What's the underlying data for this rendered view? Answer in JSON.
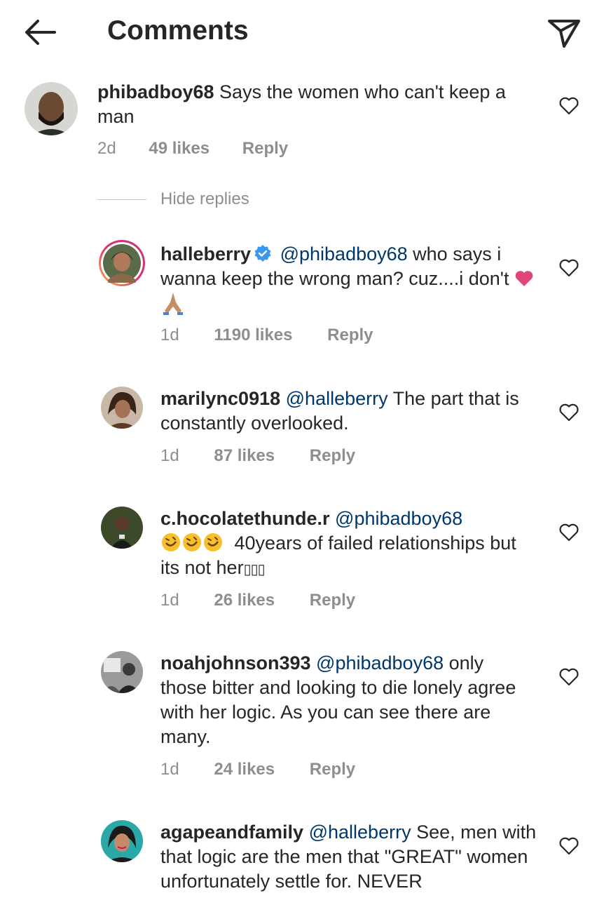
{
  "header": {
    "title": "Comments",
    "back_icon": "arrow-left-icon",
    "send_icon": "paper-plane-icon"
  },
  "comments": [
    {
      "username": "phibadboy68",
      "text": "Says the women who can't keep a man",
      "time": "2d",
      "likes": "49 likes",
      "reply": "Reply"
    }
  ],
  "hide_replies": "Hide replies",
  "replies": [
    {
      "username": "halleberry",
      "verified": true,
      "mention": "@phibadboy68",
      "text": "who says i wanna keep the wrong man?  cuz....i don't",
      "time": "1d",
      "likes": "1190 likes",
      "reply": "Reply"
    },
    {
      "username": "marilync0918",
      "mention": "@halleberry",
      "text": "The part that is constantly overlooked.",
      "time": "1d",
      "likes": "87 likes",
      "reply": "Reply"
    },
    {
      "username": "c.hocolatethunde.r",
      "mention": "@phibadboy68",
      "text": "40years of failed relationships but its not her",
      "text_suffix": "▯▯▯",
      "time": "1d",
      "likes": "26 likes",
      "reply": "Reply"
    },
    {
      "username": "noahjohnson393",
      "mention": "@phibadboy68",
      "text": "only those bitter and looking to die lonely agree with her logic. As you can see there are many.",
      "time": "1d",
      "likes": "24 likes",
      "reply": "Reply"
    },
    {
      "username": "agapeandfamily",
      "mention": "@halleberry",
      "text": "See, men with that logic are the men that \"GREAT\" women unfortunately settle for. NEVER",
      "time": "",
      "likes": "",
      "reply": ""
    }
  ],
  "colors": {
    "text": "#262626",
    "secondary": "#8e8e8e",
    "mention": "#00376b",
    "verified": "#3897f0",
    "heart_emoji": "#e0457b"
  }
}
